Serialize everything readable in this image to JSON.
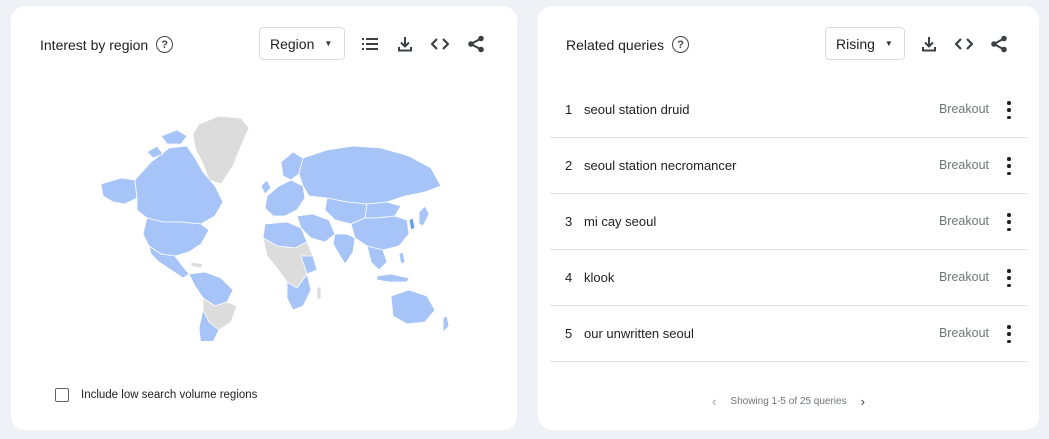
{
  "colors": {
    "background": "#eef1f6",
    "card": "#ffffff",
    "map_highlight": "#a6c4f7",
    "map_nodata": "#dcdcdc"
  },
  "region_card": {
    "title": "Interest by region",
    "help_icon": "help-circle-icon",
    "resolution_select": "Region",
    "toolbar_icons": [
      "list-icon",
      "download-icon",
      "embed-code-icon",
      "share-icon"
    ],
    "include_low_volume_label": "Include low search volume regions",
    "include_low_volume_checked": false
  },
  "queries_card": {
    "title": "Related queries",
    "help_icon": "help-circle-icon",
    "filter_select": "Rising",
    "toolbar_icons": [
      "download-icon",
      "embed-code-icon",
      "share-icon"
    ],
    "rows": [
      {
        "rank": "1",
        "query": "seoul station druid",
        "value": "Breakout"
      },
      {
        "rank": "2",
        "query": "seoul station necromancer",
        "value": "Breakout"
      },
      {
        "rank": "3",
        "query": "mi cay seoul",
        "value": "Breakout"
      },
      {
        "rank": "4",
        "query": "klook",
        "value": "Breakout"
      },
      {
        "rank": "5",
        "query": "our unwritten seoul",
        "value": "Breakout"
      }
    ],
    "pagination": "Showing 1-5 of 25 queries"
  }
}
